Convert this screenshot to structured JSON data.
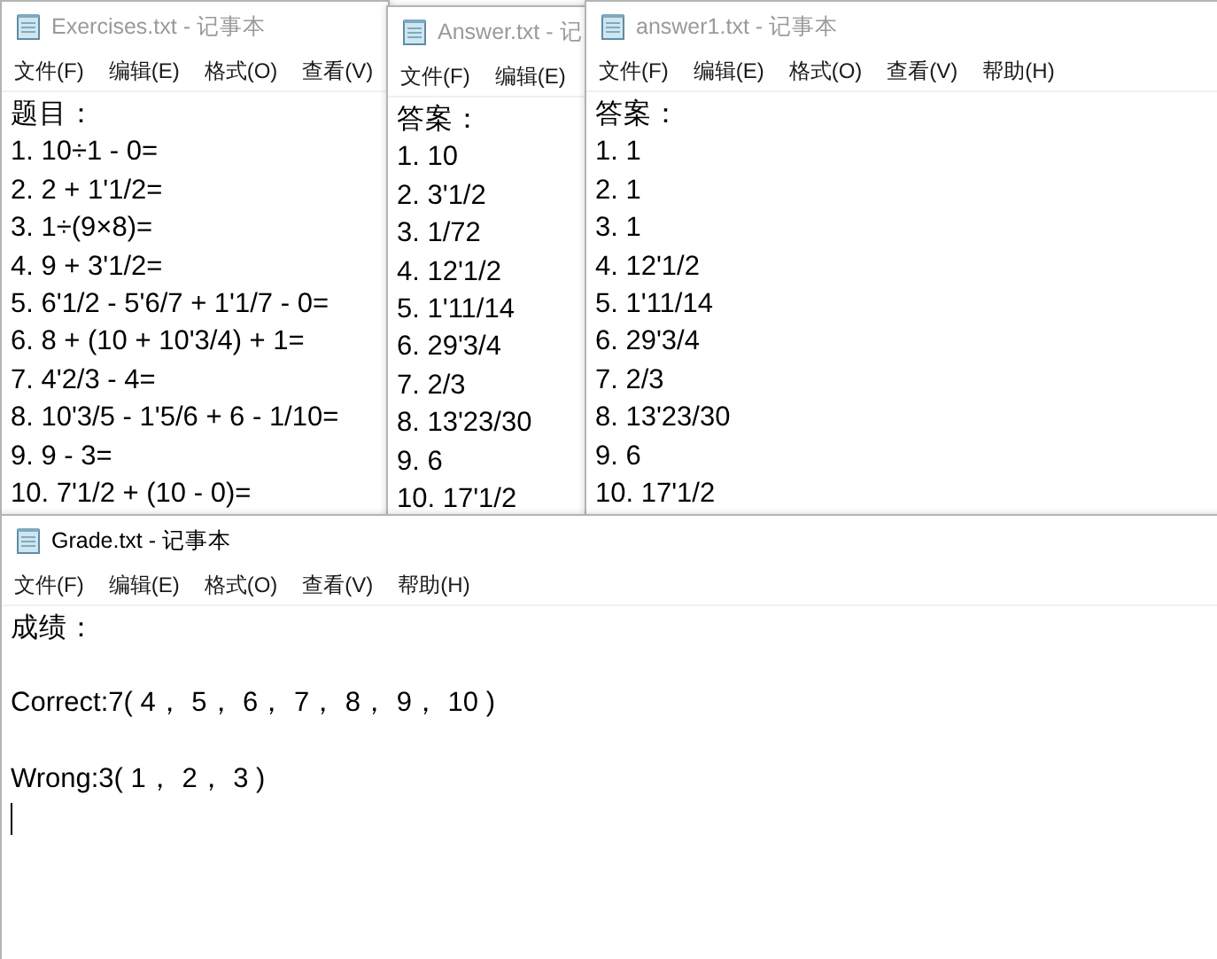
{
  "windows": [
    {
      "title": "Exercises.txt - 记事本",
      "active": false,
      "spaced": false,
      "menu": [
        "文件(F)",
        "编辑(E)",
        "格式(O)",
        "查看(V)"
      ],
      "lines": [
        "题目：",
        "1. 10÷1 - 0=",
        "2. 2 + 1'1/2=",
        "3. 1÷(9×8)=",
        "4. 9 + 3'1/2=",
        "5. 6'1/2 - 5'6/7 + 1'1/7 - 0=",
        "6. 8 + (10 + 10'3/4) + 1=",
        "7. 4'2/3 - 4=",
        "8. 10'3/5 - 1'5/6 + 6 - 1/10=",
        "9. 9 - 3=",
        "10. 7'1/2 + (10 - 0)="
      ]
    },
    {
      "title": "Answer.txt - 记",
      "active": false,
      "spaced": false,
      "menu": [
        "文件(F)",
        "编辑(E)"
      ],
      "lines": [
        "答案：",
        "1. 10",
        "2. 3'1/2",
        "3. 1/72",
        "4. 12'1/2",
        "5. 1'11/14",
        "6. 29'3/4",
        "7. 2/3",
        "8. 13'23/30",
        "9. 6",
        "10. 17'1/2"
      ]
    },
    {
      "title": "answer1.txt - 记事本",
      "active": false,
      "spaced": false,
      "menu": [
        "文件(F)",
        "编辑(E)",
        "格式(O)",
        "查看(V)",
        "帮助(H)"
      ],
      "lines": [
        "答案：",
        "1. 1",
        "2. 1",
        "3. 1",
        "4. 12'1/2",
        "5. 1'11/14",
        "6. 29'3/4",
        "7. 2/3",
        "8. 13'23/30",
        "9. 6",
        "10. 17'1/2"
      ]
    },
    {
      "title": "Grade.txt - 记事本",
      "active": true,
      "spaced": true,
      "menu": [
        "文件(F)",
        "编辑(E)",
        "格式(O)",
        "查看(V)",
        "帮助(H)"
      ],
      "lines": [
        "成绩：",
        "Correct:7( 4， 5， 6， 7， 8， 9， 10 )",
        "Wrong:3( 1， 2， 3 )"
      ]
    }
  ]
}
